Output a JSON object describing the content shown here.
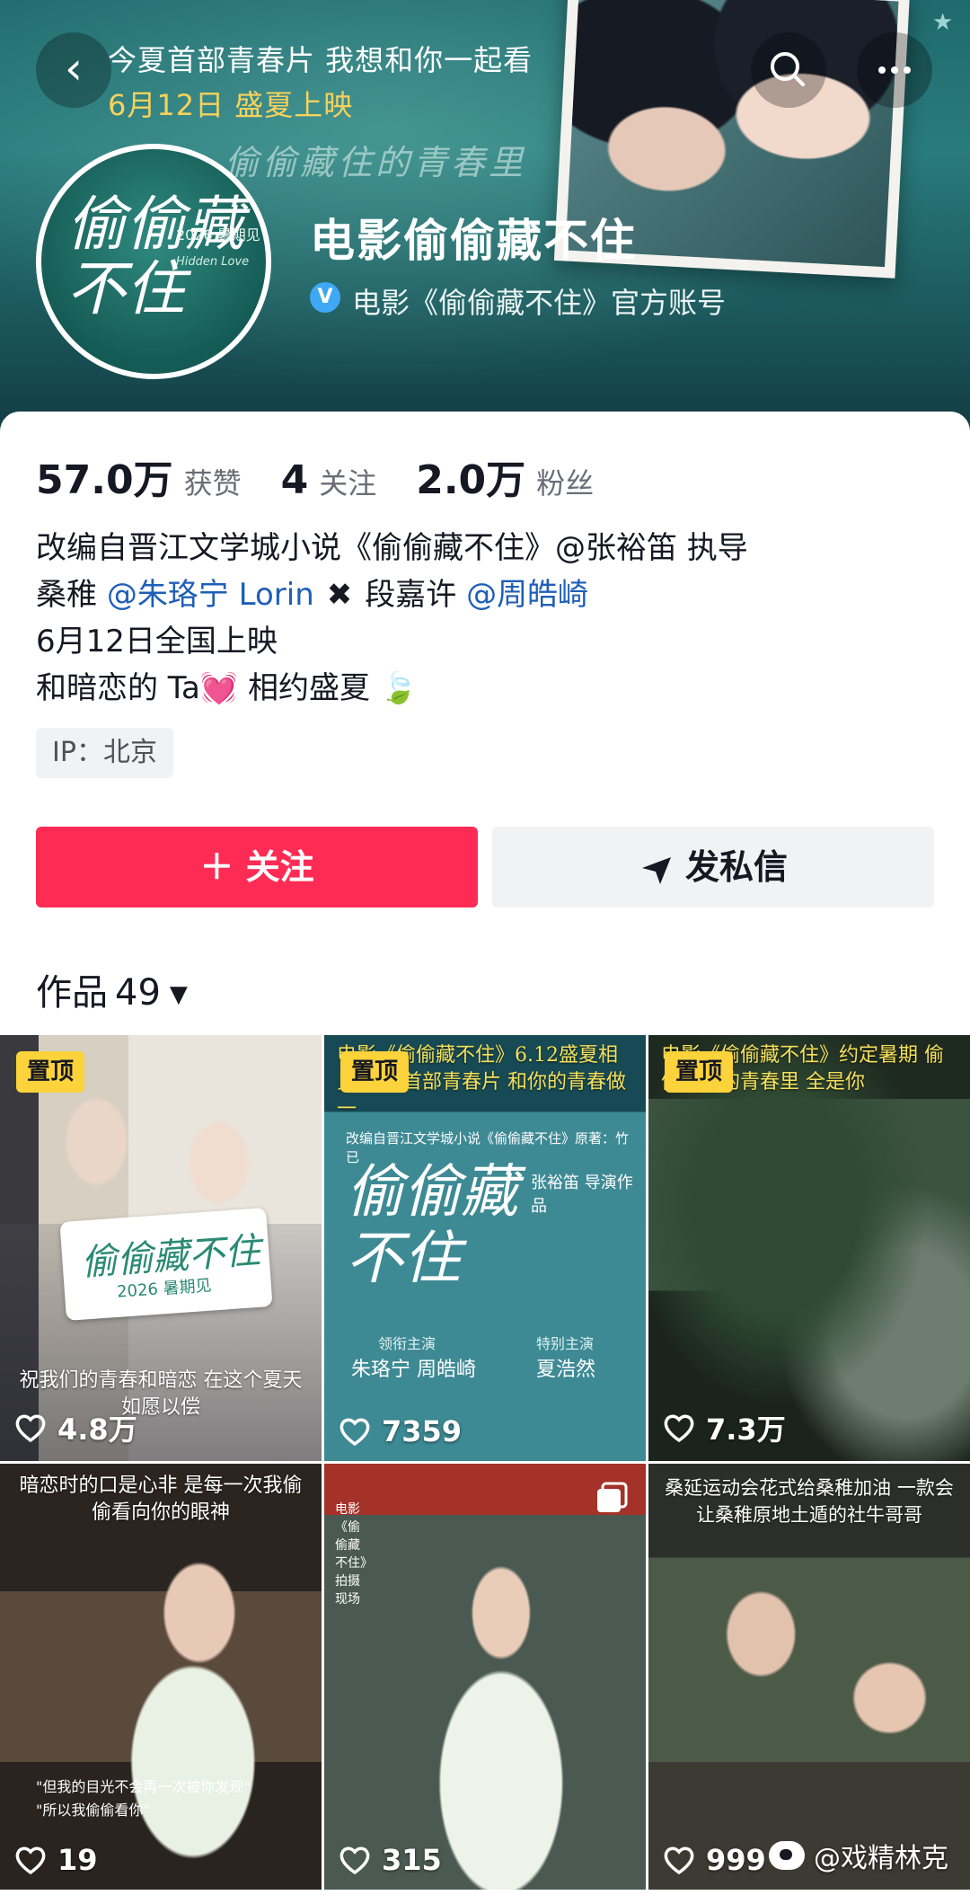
{
  "banner": {
    "promo_line_1": "今夏首部青春片  我想和你一起看",
    "promo_line_2": "6月12日  盛夏上映",
    "script_text": "偷偷藏住的青春里",
    "avatar_logo": "偷偷藏不住",
    "avatar_year": "2026 暑期见",
    "avatar_en": "Hidden Love",
    "account_name": "电影偷偷藏不住",
    "verified_text": "电影《偷偷藏不住》官方账号",
    "back_icon": "chevron-left-icon",
    "search_icon": "search-icon",
    "more_icon": "more-icon"
  },
  "stats": [
    {
      "value": "57.0万",
      "label": "获赞"
    },
    {
      "value": "4",
      "label": "关注"
    },
    {
      "value": "2.0万",
      "label": "粉丝"
    }
  ],
  "bio": {
    "line1": "改编自晋江文学城小说《偷偷藏不住》@张裕笛 执导",
    "line2_a": "桑稚 ",
    "line2_mention1": "@朱珞宁 Lorin",
    "line2_cross": "✖",
    "line2_b": "段嘉许 ",
    "line2_mention2": "@周皓崎",
    "line3": "6月12日全国上映",
    "line4_a": "和暗恋的 Ta",
    "line4_heart": "💓",
    "line4_b": " 相约盛夏",
    "line4_leaf": "🍃"
  },
  "ip_tag": "IP：北京",
  "actions": {
    "follow_label": "＋ 关注",
    "message_label": "发私信"
  },
  "works": {
    "label": "作品",
    "count": "49",
    "caret": "▼"
  },
  "videos": [
    {
      "pinned": "置顶",
      "likes": "4.8万",
      "caption": "祝我们的青春和暗恋 在这个夏天如愿以偿",
      "logo": "偷偷藏不住",
      "logo_sub": "2026 暑期见"
    },
    {
      "pinned": "置顶",
      "likes": "7359",
      "caption": "电影《偷偷藏不住》6.12盛夏相见 今夏首部青春片 和你的青春做一",
      "poster_sub": "改编自晋江文学城小说《偷偷藏不住》原著：竹已",
      "logo": "偷偷藏不住",
      "director": "张裕笛 导演作品",
      "leads_label": "领衔主演",
      "leads": "朱珞宁  周皓崎",
      "special_label": "特别主演",
      "special": "夏浩然"
    },
    {
      "pinned": "置顶",
      "likes": "7.3万",
      "caption": "电影《偷偷藏不住》约定暑期 偷偷藏住的青春里 全是你"
    },
    {
      "likes": "19",
      "caption": "暗恋时的口是心非 是每一次我偷偷看向你的眼神",
      "sub_caption_1": "\"但我的目光不会再一次被你发现\"",
      "sub_caption_2": "\"所以我偷偷看你\""
    },
    {
      "likes": "315",
      "caption": "电影《偷偷藏不住》拍摄现场",
      "multi_icon": "multi-image-icon"
    },
    {
      "likes": "999",
      "caption": "桑延运动会花式给桑稚加油 一款会让桑稚原地土遁的社牛哥哥"
    }
  ],
  "watermark": "@戏精林克",
  "colors": {
    "follow": "#fe2c55",
    "mention": "#1f5fb8",
    "pin": "#fcd33a",
    "promo_yellow": "#f7d25c",
    "verified": "#3fa8f4"
  }
}
